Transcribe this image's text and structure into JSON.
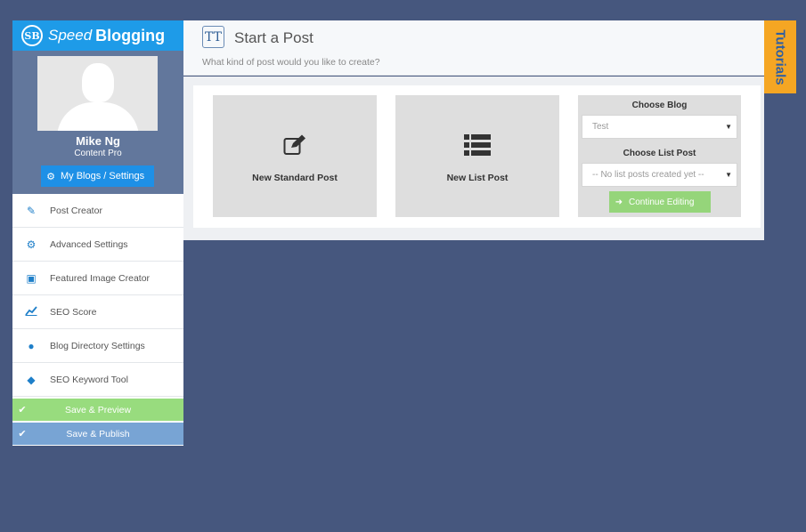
{
  "brand": {
    "speed": "Speed",
    "blogging": "Blogging",
    "logo_text": "SB"
  },
  "profile": {
    "name": "Mike Ng",
    "role": "Content Pro",
    "settings_button": "My Blogs / Settings"
  },
  "menu": {
    "items": [
      {
        "label": "Post Creator",
        "icon": "edit-icon"
      },
      {
        "label": "Advanced Settings",
        "icon": "gears-icon"
      },
      {
        "label": "Featured Image Creator",
        "icon": "image-icon"
      },
      {
        "label": "SEO Score",
        "icon": "chart-icon"
      },
      {
        "label": "Blog Directory Settings",
        "icon": "globe-icon"
      },
      {
        "label": "SEO Keyword Tool",
        "icon": "tags-icon"
      }
    ]
  },
  "actions": {
    "save_preview": "Save & Preview",
    "save_publish": "Save & Publish"
  },
  "header": {
    "icon_text": "TT",
    "title": "Start a Post",
    "subtitle": "What kind of post would you like to create?"
  },
  "cards": {
    "standard": "New Standard Post",
    "list": "New List Post"
  },
  "chooser": {
    "blog_label": "Choose Blog",
    "blog_value": "Test",
    "list_label": "Choose List Post",
    "list_value": "-- No list posts created yet --",
    "continue": "Continue Editing"
  },
  "tutorials": "Tutorials",
  "colors": {
    "brand": "#1e9be8",
    "background": "#46577e",
    "tutorials_tab": "#f5a623",
    "preview": "#98dc7e",
    "publish": "#78a4d4"
  }
}
